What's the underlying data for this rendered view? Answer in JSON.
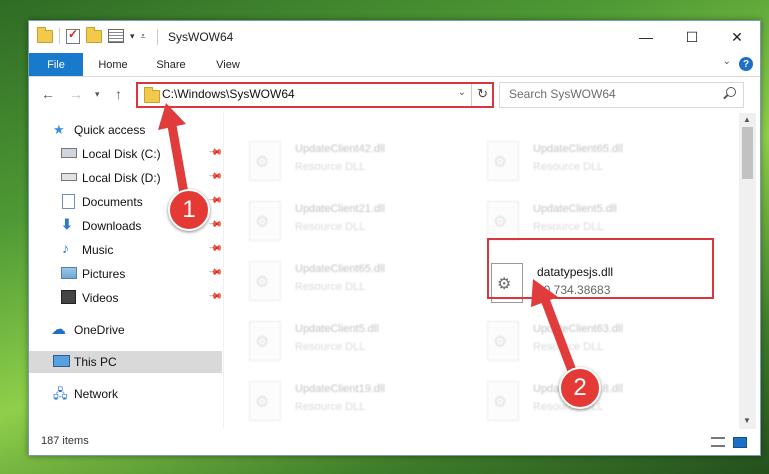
{
  "window": {
    "title": "SysWOW64"
  },
  "ribbon": {
    "tabs": [
      "File",
      "Home",
      "Share",
      "View"
    ]
  },
  "address": {
    "path": "C:\\Windows\\SysWOW64"
  },
  "search": {
    "placeholder": "Search SysWOW64"
  },
  "sidebar": {
    "items": [
      {
        "label": "Quick access",
        "icon": "star-icon"
      },
      {
        "label": "Local Disk (C:)",
        "icon": "drive-icon",
        "pinned": true
      },
      {
        "label": "Local Disk (D:)",
        "icon": "drive-icon",
        "pinned": true
      },
      {
        "label": "Documents",
        "icon": "documents-icon",
        "pinned": true
      },
      {
        "label": "Downloads",
        "icon": "download-icon",
        "pinned": true
      },
      {
        "label": "Music",
        "icon": "music-icon",
        "pinned": true
      },
      {
        "label": "Pictures",
        "icon": "pictures-icon",
        "pinned": true
      },
      {
        "label": "Videos",
        "icon": "videos-icon",
        "pinned": true
      },
      {
        "label": "OneDrive",
        "icon": "cloud-icon"
      },
      {
        "label": "This PC",
        "icon": "computer-icon",
        "selected": true
      },
      {
        "label": "Network",
        "icon": "network-icon"
      }
    ]
  },
  "files": [
    {
      "name": "UpdateClient42.dll",
      "type": "Resource DLL"
    },
    {
      "name": "UpdateClient65.dll",
      "type": "Resource DLL"
    },
    {
      "name": "UpdateClient21.dll",
      "type": "Resource DLL"
    },
    {
      "name": "UpdateClient5.dll",
      "type": "Resource DLL"
    },
    {
      "name": "UpdateClient65.dll",
      "type": "Resource DLL"
    },
    {
      "name": "datatypesjs.dll",
      "type": "10.734.38683"
    },
    {
      "name": "UpdateClient5.dll",
      "type": "Resource DLL"
    },
    {
      "name": "UpdateClient63.dll",
      "type": "Resource DLL"
    },
    {
      "name": "UpdateClient19.dll",
      "type": "Resource DLL"
    },
    {
      "name": "UpdateClient18.dll",
      "type": "Resource DLL"
    }
  ],
  "status": {
    "item_count": "187 items"
  },
  "annotations": {
    "step1": "1",
    "step2": "2"
  },
  "colors": {
    "accent": "#1979ca",
    "annotation": "#e03c3c"
  }
}
